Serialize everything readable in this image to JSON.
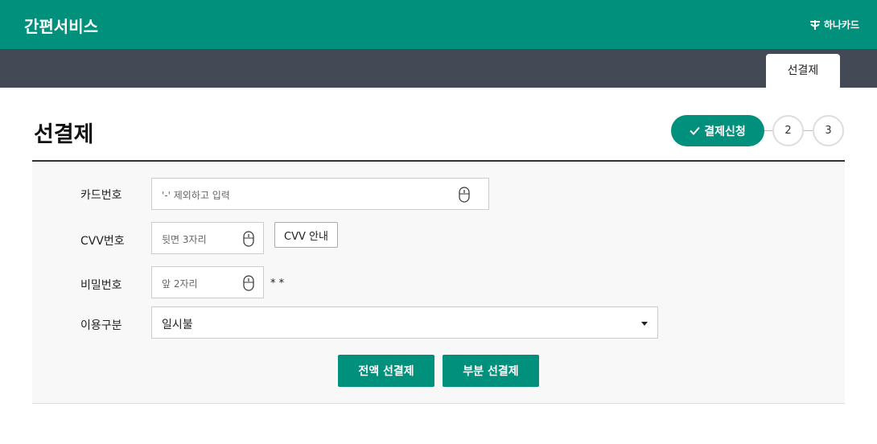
{
  "header": {
    "title": "간편서비스",
    "logo_text": "하나카드",
    "brand_color": "#00907c"
  },
  "subnav": {
    "active_tab": "선결제"
  },
  "page": {
    "title": "선결제"
  },
  "steps": {
    "active_label": "결제신청",
    "step2": "2",
    "step3": "3"
  },
  "form": {
    "card_number": {
      "label": "카드번호",
      "placeholder": "'-' 제외하고 입력"
    },
    "cvv": {
      "label": "CVV번호",
      "placeholder": "뒷면 3자리",
      "guide_button": "CVV 안내"
    },
    "password": {
      "label": "비밀번호",
      "placeholder": "앞 2자리",
      "suffix": "* *"
    },
    "usage_type": {
      "label": "이용구분",
      "selected": "일시불"
    }
  },
  "actions": {
    "full_prepay": "전액 선결제",
    "partial_prepay": "부분 선결제"
  }
}
